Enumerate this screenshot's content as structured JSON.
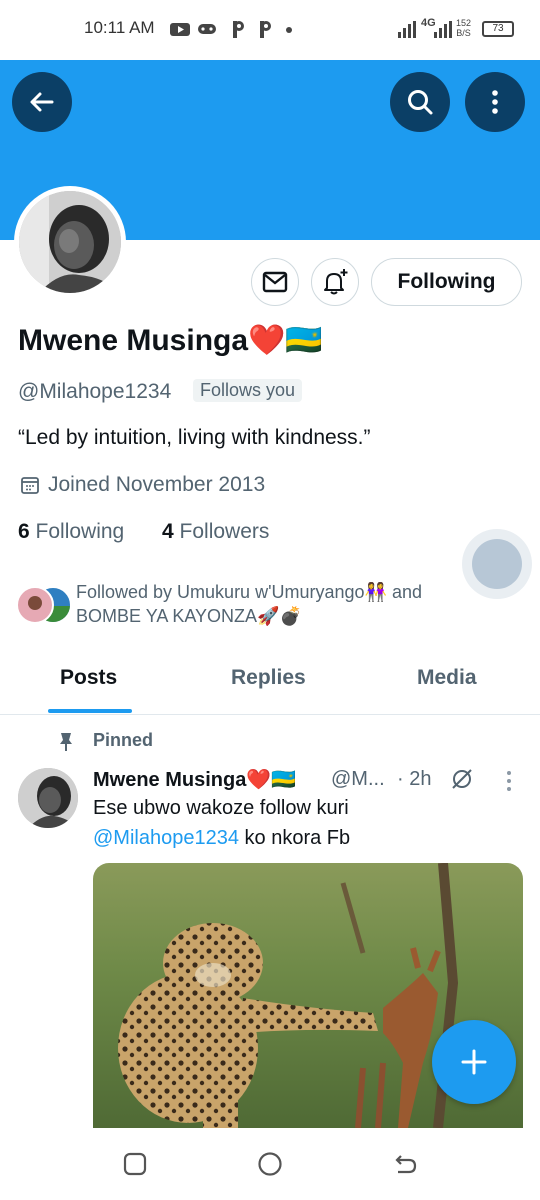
{
  "status_bar": {
    "time": "10:11 AM",
    "app_icons": [
      "youtube-icon",
      "gamepad-icon",
      "p-icon",
      "p-icon",
      "dot-icon"
    ],
    "signal_1": "ıll",
    "network": "4G",
    "signal_2": "ıll",
    "net_speed_value": "152",
    "net_speed_unit": "B/S",
    "battery": "73"
  },
  "header": {
    "back_icon": "back-arrow-icon",
    "search_icon": "search-icon",
    "more_icon": "more-vertical-icon",
    "banner_color": "#1d9bf0"
  },
  "profile": {
    "display_name": "Mwene Musinga❤️🇷🇼",
    "handle": "@Milahope1234",
    "follows_you": "Follows you",
    "bio": "“Led by intuition, living with kindness.”",
    "joined": "Joined November 2013",
    "following_count": "6",
    "following_label": "Following",
    "followers_count": "4",
    "followers_label": "Followers",
    "following_button": "Following",
    "followed_by_line1": "Followed by Umukuru w'Umuryango👭 and",
    "followed_by_line2": "BOMBE YA KAYONZA🚀💣"
  },
  "tabs": [
    {
      "label": "Posts",
      "active": true
    },
    {
      "label": "Replies",
      "active": false
    },
    {
      "label": "Media",
      "active": false
    }
  ],
  "post": {
    "pinned_label": "Pinned",
    "author_name": "Mwene Musinga❤️🇷🇼",
    "author_handle": "@M...",
    "time": "· 2h",
    "text_line1": "Ese ubwo wakoze follow kuri",
    "text_mention": "@Milahope1234",
    "text_line2_rest": " ko nkora Fb",
    "media_description_icon": "leopard-and-antelope-photo"
  },
  "fab": {
    "icon": "plus-icon"
  },
  "navbar": {
    "icons": [
      "recents-icon",
      "home-icon",
      "back-icon"
    ]
  },
  "colors": {
    "accent": "#1d9bf0",
    "dark_button": "#0b3f66",
    "secondary_text": "#536471"
  }
}
